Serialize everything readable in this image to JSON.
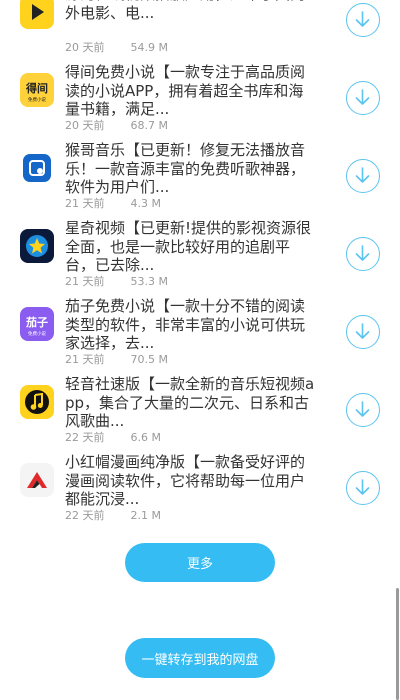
{
  "apps": [
    {
      "icon": "yellow-play-icon",
      "title": "源的在线视频播放应用，汇聚了国内外电影、电...",
      "lead": "",
      "time": "20 天前",
      "size": "54.9 M"
    },
    {
      "icon": "dejian-novel-icon",
      "title": "得间免费小说【一款专注于高品质阅读的小说APP，拥有着超全书库和海量书籍，满足...",
      "time": "20 天前",
      "size": "68.7 M"
    },
    {
      "icon": "monkey-music-icon",
      "title": "猴哥音乐【已更新！修复无法播放音乐！一款音源丰富的免费听歌神器，软件为用户们...",
      "time": "21 天前",
      "size": "4.3 M"
    },
    {
      "icon": "star-video-icon",
      "title": "星奇视频【已更新!提供的影视资源很全面，也是一款比较好用的追剧平台，已去除...",
      "time": "21 天前",
      "size": "53.3 M"
    },
    {
      "icon": "qiezi-novel-icon",
      "title": "茄子免费小说【一款十分不错的阅读类型的软件，非常丰富的小说可供玩家选择，去...",
      "time": "21 天前",
      "size": "70.5 M"
    },
    {
      "icon": "music-note-icon",
      "title": "轻音社速版【一款全新的音乐短视频app，集合了大量的二次元、日系和古风歌曲...",
      "time": "22 天前",
      "size": "6.6 M"
    },
    {
      "icon": "red-hat-comic-icon",
      "title": "小红帽漫画纯净版【一款备受好评的漫画阅读软件，它将帮助每一位用户都能沉浸...",
      "time": "22 天前",
      "size": "2.1 M"
    }
  ],
  "icon_text": {
    "dejian_top": "得间",
    "dejian_sub": "免费小说",
    "qiezi_top": "茄子",
    "qiezi_sub": "免费小说"
  },
  "buttons": {
    "more": "更多",
    "save_to_disk": "一键转存到我的网盘"
  },
  "colors": {
    "accent": "#35bdf3",
    "title_text": "#333333",
    "meta_text": "#9a9a9a"
  }
}
